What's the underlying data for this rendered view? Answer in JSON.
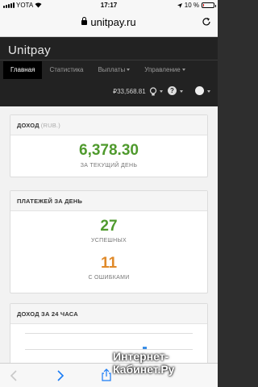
{
  "status_bar": {
    "carrier": "YOTA",
    "time": "17:17",
    "battery": "10 %",
    "battery_level": 0.1
  },
  "address_bar": {
    "url": "unitpay.ru"
  },
  "app": {
    "brand": "Unitpay",
    "menu": [
      {
        "label": "Главная",
        "active": true
      },
      {
        "label": "Статистика"
      },
      {
        "label": "Выплаты"
      },
      {
        "label": "Управление"
      }
    ],
    "balance": "₽33,568.81"
  },
  "panels": {
    "income": {
      "title": "ДОХОД",
      "subtitle": "(RUB.)",
      "value": "6,378.30",
      "caption": "ЗА ТЕКУЩИЙ ДЕНЬ"
    },
    "payments": {
      "title": "ПЛАТЕЖЕЙ ЗА ДЕНЬ",
      "success_value": "27",
      "success_caption": "УСПЕШНЫХ",
      "error_value": "11",
      "error_caption": "С ОШИБКАМИ"
    },
    "income24": {
      "title": "ДОХОД ЗА 24 ЧАСА"
    }
  },
  "watermark": {
    "line1": "Интернет-",
    "line2": "Кабинет.Ру"
  },
  "colors": {
    "accent_green": "#4f9a2d",
    "accent_orange": "#e08a2a",
    "nav_bg": "#222222",
    "blue": "#3a8ee6"
  }
}
